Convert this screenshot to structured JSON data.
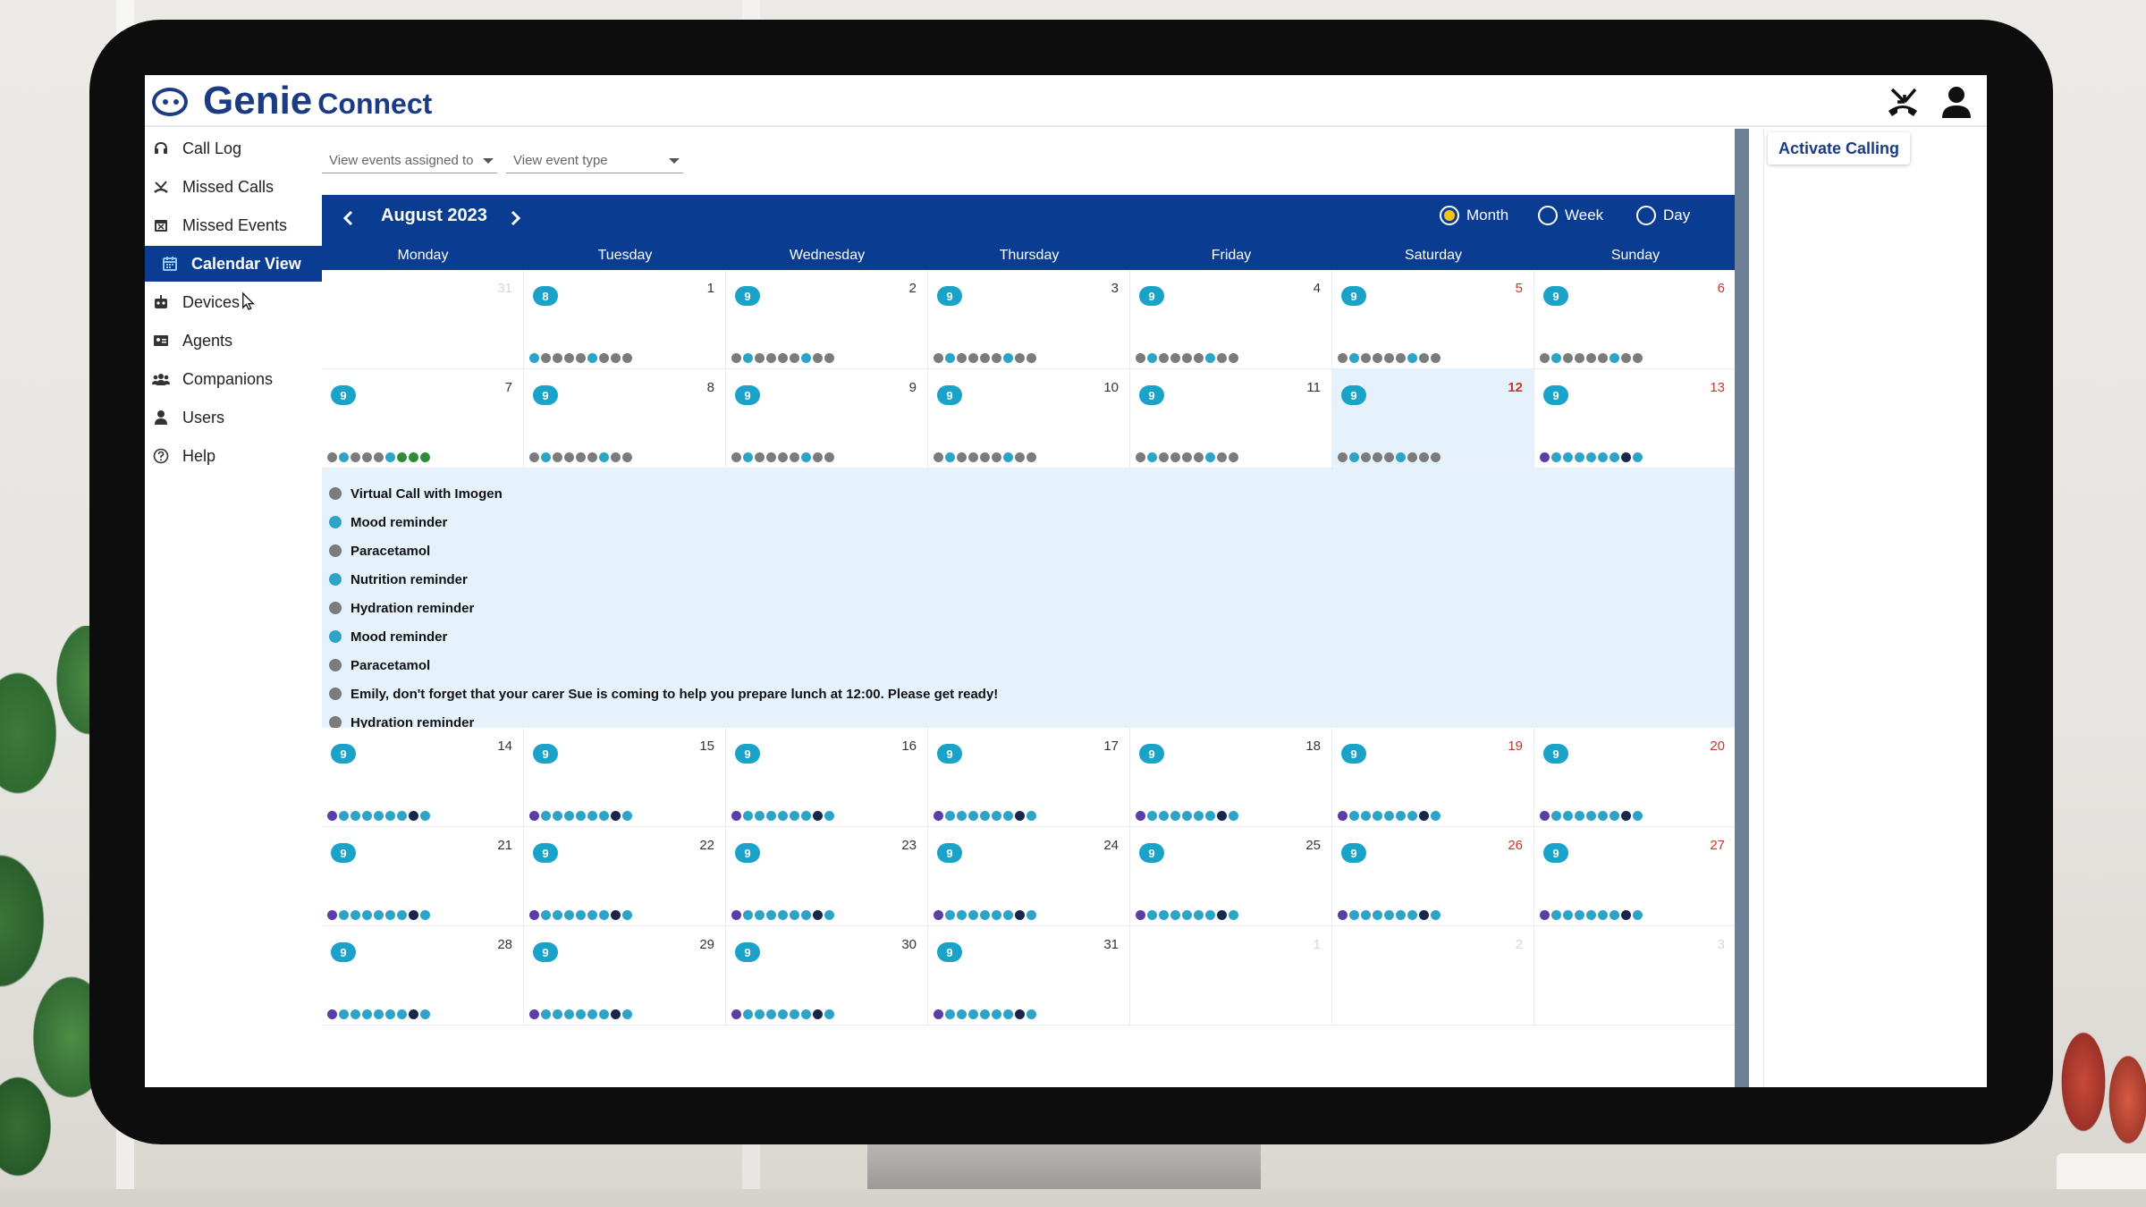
{
  "app": {
    "brand_name": "Genie",
    "brand_sub": "Connect"
  },
  "header": {
    "icons": [
      "missed-call-icon",
      "user-icon"
    ]
  },
  "sidebar": {
    "items": [
      {
        "label": "Call Log",
        "icon": "headset-icon"
      },
      {
        "label": "Missed Calls",
        "icon": "missed-call-icon"
      },
      {
        "label": "Missed Events",
        "icon": "calendar-x-icon"
      },
      {
        "label": "Calendar View",
        "icon": "calendar-icon",
        "active": true
      },
      {
        "label": "Devices",
        "icon": "robot-icon"
      },
      {
        "label": "Agents",
        "icon": "id-card-icon"
      },
      {
        "label": "Companions",
        "icon": "group-icon"
      },
      {
        "label": "Users",
        "icon": "user-icon"
      },
      {
        "label": "Help",
        "icon": "help-icon"
      }
    ]
  },
  "filters": {
    "assigned_to": "View events assigned to",
    "event_type": "View event type"
  },
  "calendar": {
    "month_label": "August 2023",
    "view_options": [
      {
        "label": "Month",
        "selected": true
      },
      {
        "label": "Week",
        "selected": false
      },
      {
        "label": "Day",
        "selected": false
      }
    ],
    "weekdays": [
      "Monday",
      "Tuesday",
      "Wednesday",
      "Thursday",
      "Friday",
      "Saturday",
      "Sunday"
    ],
    "weeks": [
      [
        {
          "day": "31",
          "dim": true
        },
        {
          "day": "1",
          "badge": "8",
          "dots": [
            "teal",
            "grey",
            "grey",
            "grey",
            "grey",
            "teal",
            "grey",
            "grey",
            "grey"
          ]
        },
        {
          "day": "2",
          "badge": "9",
          "dots": [
            "grey",
            "teal",
            "grey",
            "grey",
            "grey",
            "grey",
            "teal",
            "grey",
            "grey"
          ]
        },
        {
          "day": "3",
          "badge": "9",
          "dots": [
            "grey",
            "teal",
            "grey",
            "grey",
            "grey",
            "grey",
            "teal",
            "grey",
            "grey"
          ]
        },
        {
          "day": "4",
          "badge": "9",
          "dots": [
            "grey",
            "teal",
            "grey",
            "grey",
            "grey",
            "grey",
            "teal",
            "grey",
            "grey"
          ]
        },
        {
          "day": "5",
          "badge": "9",
          "dots": [
            "grey",
            "teal",
            "grey",
            "grey",
            "grey",
            "grey",
            "teal",
            "grey",
            "grey"
          ],
          "weekend": true
        },
        {
          "day": "6",
          "badge": "9",
          "dots": [
            "grey",
            "teal",
            "grey",
            "grey",
            "grey",
            "grey",
            "teal",
            "grey",
            "grey"
          ],
          "weekend": true
        }
      ],
      [
        {
          "day": "7",
          "badge": "9",
          "dots": [
            "grey",
            "teal",
            "grey",
            "grey",
            "grey",
            "teal",
            "green",
            "green",
            "green"
          ]
        },
        {
          "day": "8",
          "badge": "9",
          "dots": [
            "grey",
            "teal",
            "grey",
            "grey",
            "grey",
            "grey",
            "teal",
            "grey",
            "grey"
          ]
        },
        {
          "day": "9",
          "badge": "9",
          "dots": [
            "grey",
            "teal",
            "grey",
            "grey",
            "grey",
            "grey",
            "teal",
            "grey",
            "grey"
          ]
        },
        {
          "day": "10",
          "badge": "9",
          "dots": [
            "grey",
            "teal",
            "grey",
            "grey",
            "grey",
            "grey",
            "teal",
            "grey",
            "grey"
          ]
        },
        {
          "day": "11",
          "badge": "9",
          "dots": [
            "grey",
            "teal",
            "grey",
            "grey",
            "grey",
            "grey",
            "teal",
            "grey",
            "grey"
          ]
        },
        {
          "day": "12",
          "badge": "9",
          "dots": [
            "grey",
            "teal",
            "grey",
            "grey",
            "grey",
            "teal",
            "grey",
            "grey",
            "grey"
          ],
          "today": true
        },
        {
          "day": "13",
          "badge": "9",
          "dots": [
            "purple",
            "teal",
            "teal",
            "teal",
            "teal",
            "teal",
            "teal",
            "navy",
            "teal"
          ],
          "weekend": true
        }
      ],
      [
        {
          "day": "14",
          "badge": "9",
          "dots": [
            "purple",
            "teal",
            "teal",
            "teal",
            "teal",
            "teal",
            "teal",
            "navy",
            "teal"
          ]
        },
        {
          "day": "15",
          "badge": "9",
          "dots": [
            "purple",
            "teal",
            "teal",
            "teal",
            "teal",
            "teal",
            "teal",
            "navy",
            "teal"
          ]
        },
        {
          "day": "16",
          "badge": "9",
          "dots": [
            "purple",
            "teal",
            "teal",
            "teal",
            "teal",
            "teal",
            "teal",
            "navy",
            "teal"
          ]
        },
        {
          "day": "17",
          "badge": "9",
          "dots": [
            "purple",
            "teal",
            "teal",
            "teal",
            "teal",
            "teal",
            "teal",
            "navy",
            "teal"
          ]
        },
        {
          "day": "18",
          "badge": "9",
          "dots": [
            "purple",
            "teal",
            "teal",
            "teal",
            "teal",
            "teal",
            "teal",
            "navy",
            "teal"
          ]
        },
        {
          "day": "19",
          "badge": "9",
          "dots": [
            "purple",
            "teal",
            "teal",
            "teal",
            "teal",
            "teal",
            "teal",
            "navy",
            "teal"
          ],
          "weekend": true
        },
        {
          "day": "20",
          "badge": "9",
          "dots": [
            "purple",
            "teal",
            "teal",
            "teal",
            "teal",
            "teal",
            "teal",
            "navy",
            "teal"
          ],
          "weekend": true
        }
      ],
      [
        {
          "day": "21",
          "badge": "9",
          "dots": [
            "purple",
            "teal",
            "teal",
            "teal",
            "teal",
            "teal",
            "teal",
            "navy",
            "teal"
          ]
        },
        {
          "day": "22",
          "badge": "9",
          "dots": [
            "purple",
            "teal",
            "teal",
            "teal",
            "teal",
            "teal",
            "teal",
            "navy",
            "teal"
          ]
        },
        {
          "day": "23",
          "badge": "9",
          "dots": [
            "purple",
            "teal",
            "teal",
            "teal",
            "teal",
            "teal",
            "teal",
            "navy",
            "teal"
          ]
        },
        {
          "day": "24",
          "badge": "9",
          "dots": [
            "purple",
            "teal",
            "teal",
            "teal",
            "teal",
            "teal",
            "teal",
            "navy",
            "teal"
          ]
        },
        {
          "day": "25",
          "badge": "9",
          "dots": [
            "purple",
            "teal",
            "teal",
            "teal",
            "teal",
            "teal",
            "teal",
            "navy",
            "teal"
          ]
        },
        {
          "day": "26",
          "badge": "9",
          "dots": [
            "purple",
            "teal",
            "teal",
            "teal",
            "teal",
            "teal",
            "teal",
            "navy",
            "teal"
          ],
          "weekend": true
        },
        {
          "day": "27",
          "badge": "9",
          "dots": [
            "purple",
            "teal",
            "teal",
            "teal",
            "teal",
            "teal",
            "teal",
            "navy",
            "teal"
          ],
          "weekend": true
        }
      ],
      [
        {
          "day": "28",
          "badge": "9",
          "dots": [
            "purple",
            "teal",
            "teal",
            "teal",
            "teal",
            "teal",
            "teal",
            "navy",
            "teal"
          ]
        },
        {
          "day": "29",
          "badge": "9",
          "dots": [
            "purple",
            "teal",
            "teal",
            "teal",
            "teal",
            "teal",
            "teal",
            "navy",
            "teal"
          ]
        },
        {
          "day": "30",
          "badge": "9",
          "dots": [
            "purple",
            "teal",
            "teal",
            "teal",
            "teal",
            "teal",
            "teal",
            "navy",
            "teal"
          ]
        },
        {
          "day": "31",
          "badge": "9",
          "dots": [
            "purple",
            "teal",
            "teal",
            "teal",
            "teal",
            "teal",
            "teal",
            "navy",
            "teal"
          ]
        },
        {
          "day": "1",
          "dim": true
        },
        {
          "day": "2",
          "dim": true
        },
        {
          "day": "3",
          "dim": true
        }
      ]
    ],
    "expanded_events": [
      {
        "label": "Virtual Call with Imogen",
        "color": "grey"
      },
      {
        "label": "Mood reminder",
        "color": "teal"
      },
      {
        "label": "Paracetamol",
        "color": "grey"
      },
      {
        "label": "Nutrition reminder",
        "color": "teal"
      },
      {
        "label": "Hydration reminder",
        "color": "grey"
      },
      {
        "label": "Mood reminder",
        "color": "teal"
      },
      {
        "label": "Paracetamol",
        "color": "grey"
      },
      {
        "label": "Emily, don't forget that your carer Sue is coming to help you prepare lunch at 12:00. Please get ready!",
        "color": "grey"
      },
      {
        "label": "Hydration reminder",
        "color": "grey"
      }
    ]
  },
  "right_panel": {
    "activate_calling": "Activate Calling"
  },
  "colors": {
    "primary": "#0a3d91",
    "brand": "#1b3c84",
    "accent": "#1aa2c8",
    "radio_selected": "#f3c319",
    "today_bg": "#e6f2fb"
  }
}
